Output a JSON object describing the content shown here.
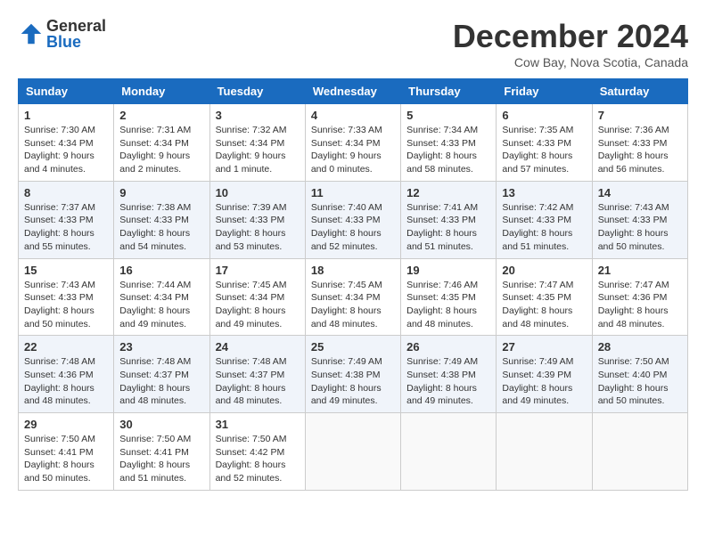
{
  "header": {
    "logo_general": "General",
    "logo_blue": "Blue",
    "month_title": "December 2024",
    "location": "Cow Bay, Nova Scotia, Canada"
  },
  "days_of_week": [
    "Sunday",
    "Monday",
    "Tuesday",
    "Wednesday",
    "Thursday",
    "Friday",
    "Saturday"
  ],
  "weeks": [
    [
      {
        "day": "1",
        "sunrise": "7:30 AM",
        "sunset": "4:34 PM",
        "daylight": "9 hours and 4 minutes."
      },
      {
        "day": "2",
        "sunrise": "7:31 AM",
        "sunset": "4:34 PM",
        "daylight": "9 hours and 2 minutes."
      },
      {
        "day": "3",
        "sunrise": "7:32 AM",
        "sunset": "4:34 PM",
        "daylight": "9 hours and 1 minute."
      },
      {
        "day": "4",
        "sunrise": "7:33 AM",
        "sunset": "4:34 PM",
        "daylight": "9 hours and 0 minutes."
      },
      {
        "day": "5",
        "sunrise": "7:34 AM",
        "sunset": "4:33 PM",
        "daylight": "8 hours and 58 minutes."
      },
      {
        "day": "6",
        "sunrise": "7:35 AM",
        "sunset": "4:33 PM",
        "daylight": "8 hours and 57 minutes."
      },
      {
        "day": "7",
        "sunrise": "7:36 AM",
        "sunset": "4:33 PM",
        "daylight": "8 hours and 56 minutes."
      }
    ],
    [
      {
        "day": "8",
        "sunrise": "7:37 AM",
        "sunset": "4:33 PM",
        "daylight": "8 hours and 55 minutes."
      },
      {
        "day": "9",
        "sunrise": "7:38 AM",
        "sunset": "4:33 PM",
        "daylight": "8 hours and 54 minutes."
      },
      {
        "day": "10",
        "sunrise": "7:39 AM",
        "sunset": "4:33 PM",
        "daylight": "8 hours and 53 minutes."
      },
      {
        "day": "11",
        "sunrise": "7:40 AM",
        "sunset": "4:33 PM",
        "daylight": "8 hours and 52 minutes."
      },
      {
        "day": "12",
        "sunrise": "7:41 AM",
        "sunset": "4:33 PM",
        "daylight": "8 hours and 51 minutes."
      },
      {
        "day": "13",
        "sunrise": "7:42 AM",
        "sunset": "4:33 PM",
        "daylight": "8 hours and 51 minutes."
      },
      {
        "day": "14",
        "sunrise": "7:43 AM",
        "sunset": "4:33 PM",
        "daylight": "8 hours and 50 minutes."
      }
    ],
    [
      {
        "day": "15",
        "sunrise": "7:43 AM",
        "sunset": "4:33 PM",
        "daylight": "8 hours and 50 minutes."
      },
      {
        "day": "16",
        "sunrise": "7:44 AM",
        "sunset": "4:34 PM",
        "daylight": "8 hours and 49 minutes."
      },
      {
        "day": "17",
        "sunrise": "7:45 AM",
        "sunset": "4:34 PM",
        "daylight": "8 hours and 49 minutes."
      },
      {
        "day": "18",
        "sunrise": "7:45 AM",
        "sunset": "4:34 PM",
        "daylight": "8 hours and 48 minutes."
      },
      {
        "day": "19",
        "sunrise": "7:46 AM",
        "sunset": "4:35 PM",
        "daylight": "8 hours and 48 minutes."
      },
      {
        "day": "20",
        "sunrise": "7:47 AM",
        "sunset": "4:35 PM",
        "daylight": "8 hours and 48 minutes."
      },
      {
        "day": "21",
        "sunrise": "7:47 AM",
        "sunset": "4:36 PM",
        "daylight": "8 hours and 48 minutes."
      }
    ],
    [
      {
        "day": "22",
        "sunrise": "7:48 AM",
        "sunset": "4:36 PM",
        "daylight": "8 hours and 48 minutes."
      },
      {
        "day": "23",
        "sunrise": "7:48 AM",
        "sunset": "4:37 PM",
        "daylight": "8 hours and 48 minutes."
      },
      {
        "day": "24",
        "sunrise": "7:48 AM",
        "sunset": "4:37 PM",
        "daylight": "8 hours and 48 minutes."
      },
      {
        "day": "25",
        "sunrise": "7:49 AM",
        "sunset": "4:38 PM",
        "daylight": "8 hours and 49 minutes."
      },
      {
        "day": "26",
        "sunrise": "7:49 AM",
        "sunset": "4:38 PM",
        "daylight": "8 hours and 49 minutes."
      },
      {
        "day": "27",
        "sunrise": "7:49 AM",
        "sunset": "4:39 PM",
        "daylight": "8 hours and 49 minutes."
      },
      {
        "day": "28",
        "sunrise": "7:50 AM",
        "sunset": "4:40 PM",
        "daylight": "8 hours and 50 minutes."
      }
    ],
    [
      {
        "day": "29",
        "sunrise": "7:50 AM",
        "sunset": "4:41 PM",
        "daylight": "8 hours and 50 minutes."
      },
      {
        "day": "30",
        "sunrise": "7:50 AM",
        "sunset": "4:41 PM",
        "daylight": "8 hours and 51 minutes."
      },
      {
        "day": "31",
        "sunrise": "7:50 AM",
        "sunset": "4:42 PM",
        "daylight": "8 hours and 52 minutes."
      },
      null,
      null,
      null,
      null
    ]
  ],
  "labels": {
    "sunrise": "Sunrise:",
    "sunset": "Sunset:",
    "daylight": "Daylight:"
  }
}
